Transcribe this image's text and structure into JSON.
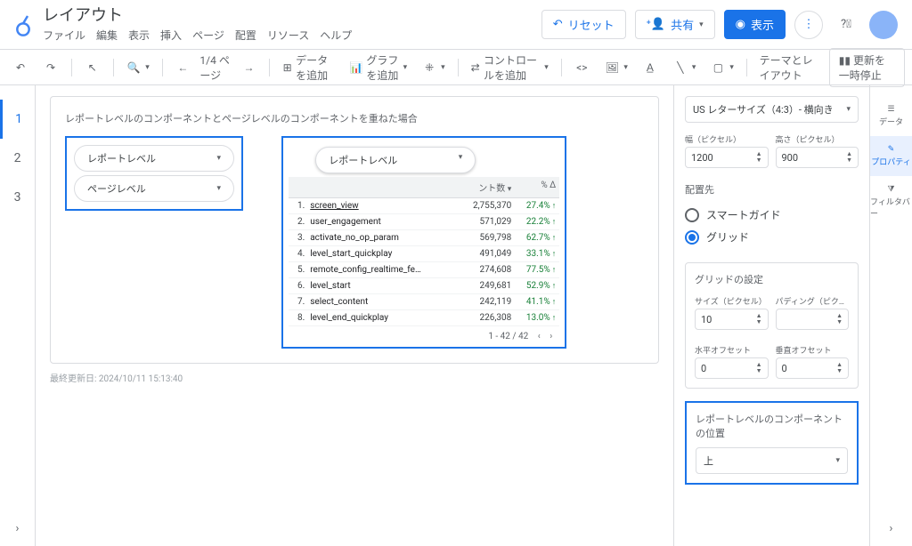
{
  "header": {
    "title": "レイアウト",
    "menu": [
      "ファイル",
      "編集",
      "表示",
      "挿入",
      "ページ",
      "配置",
      "リソース",
      "ヘルプ"
    ],
    "reset": "リセット",
    "share": "共有",
    "view": "表示"
  },
  "toolbar": {
    "page_indicator": "1/4 ページ",
    "add_data": "データを追加",
    "add_chart": "グラフを追加",
    "add_control": "コントロールを追加",
    "theme": "テーマとレイアウト",
    "pause": "更新を一時停止"
  },
  "page_tabs": [
    "1",
    "2",
    "3"
  ],
  "report": {
    "description": "レポートレベルのコンポーネントとページレベルのコンポーネントを重ねた場合",
    "dropdown1": "レポートレベル",
    "dropdown2": "ページレベル",
    "floating_dropdown": "レポートレベル",
    "col_count": "ント数",
    "col_delta": "% Δ",
    "rows": [
      {
        "idx": "1.",
        "name": "screen_view",
        "count": "2,755,370",
        "delta": "27.4%"
      },
      {
        "idx": "2.",
        "name": "user_engagement",
        "count": "571,029",
        "delta": "22.2%"
      },
      {
        "idx": "3.",
        "name": "activate_no_op_param",
        "count": "569,798",
        "delta": "62.7%"
      },
      {
        "idx": "4.",
        "name": "level_start_quickplay",
        "count": "491,049",
        "delta": "33.1%"
      },
      {
        "idx": "5.",
        "name": "remote_config_realtime_fe…",
        "count": "274,608",
        "delta": "77.5%"
      },
      {
        "idx": "6.",
        "name": "level_start",
        "count": "249,681",
        "delta": "52.9%"
      },
      {
        "idx": "7.",
        "name": "select_content",
        "count": "242,119",
        "delta": "41.1%"
      },
      {
        "idx": "8.",
        "name": "level_end_quickplay",
        "count": "226,308",
        "delta": "13.0%"
      }
    ],
    "pagination": "1 - 42 / 42",
    "last_updated": "最終更新日: 2024/10/11 15:13:40"
  },
  "props": {
    "canvas_size": "US レターサイズ（4:3）- 横向き",
    "width_label": "幅（ピクセル）",
    "width_value": "1200",
    "height_label": "高さ（ピクセル）",
    "height_value": "900",
    "align_label": "配置先",
    "align_smart": "スマートガイド",
    "align_grid": "グリッド",
    "grid_settings_label": "グリッドの設定",
    "grid_size_label": "サイズ（ピクセル）",
    "grid_size_value": "10",
    "grid_padding_label": "パディング（ピク…",
    "grid_padding_value": "",
    "grid_hoffset_label": "水平オフセット",
    "grid_hoffset_value": "0",
    "grid_voffset_label": "垂直オフセット",
    "grid_voffset_value": "0",
    "position_label": "レポートレベルのコンポーネントの位置",
    "position_value": "上"
  },
  "side_tabs": {
    "data": "データ",
    "properties": "プロパティ",
    "filter": "フィルタバー"
  }
}
